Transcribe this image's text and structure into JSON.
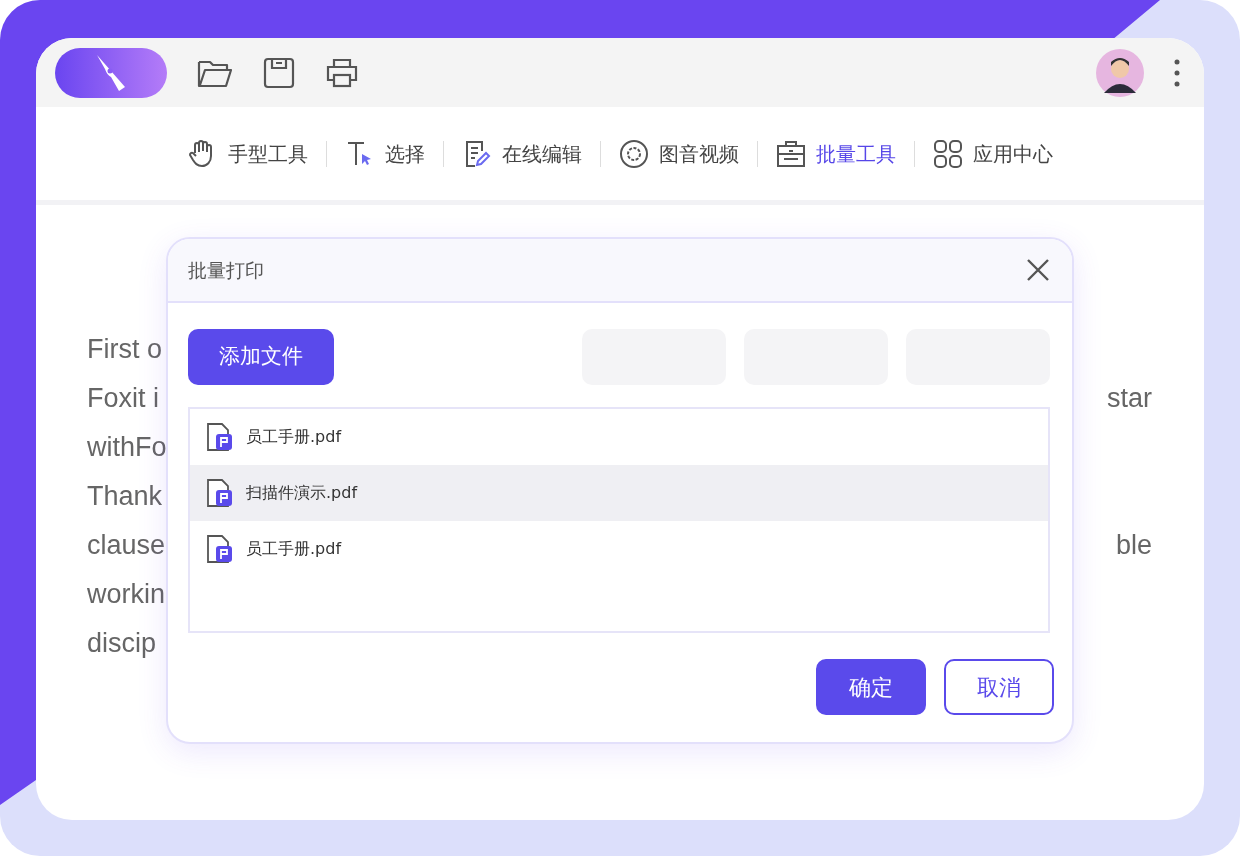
{
  "toolbar": [
    {
      "kind": "hand",
      "label": "手型工具",
      "selected": false
    },
    {
      "kind": "select",
      "label": "选择",
      "selected": false
    },
    {
      "kind": "edit",
      "label": "在线编辑",
      "selected": false
    },
    {
      "kind": "media",
      "label": "图音视频",
      "selected": false
    },
    {
      "kind": "batch",
      "label": "批量工具",
      "selected": true
    },
    {
      "kind": "apps",
      "label": "应用中心",
      "selected": false
    }
  ],
  "document": {
    "lines": [
      {
        "left": "First o"
      },
      {
        "left": "Foxit i",
        "right": "star"
      },
      {
        "left": "withFo"
      },
      {
        "left": "Thank"
      },
      {
        "left": "clause",
        "right": "ble"
      },
      {
        "left": "workin"
      },
      {
        "left": "discip"
      }
    ]
  },
  "dialog": {
    "title": "批量打印",
    "add_button": "添加文件",
    "files": [
      {
        "name": "员工手册.pdf",
        "selected": false
      },
      {
        "name": "扫描件演示.pdf",
        "selected": true
      },
      {
        "name": "员工手册.pdf",
        "selected": false
      }
    ],
    "buttons": [
      {
        "kind": "primary",
        "label": "确定"
      },
      {
        "kind": "outline",
        "label": "取消"
      }
    ]
  }
}
